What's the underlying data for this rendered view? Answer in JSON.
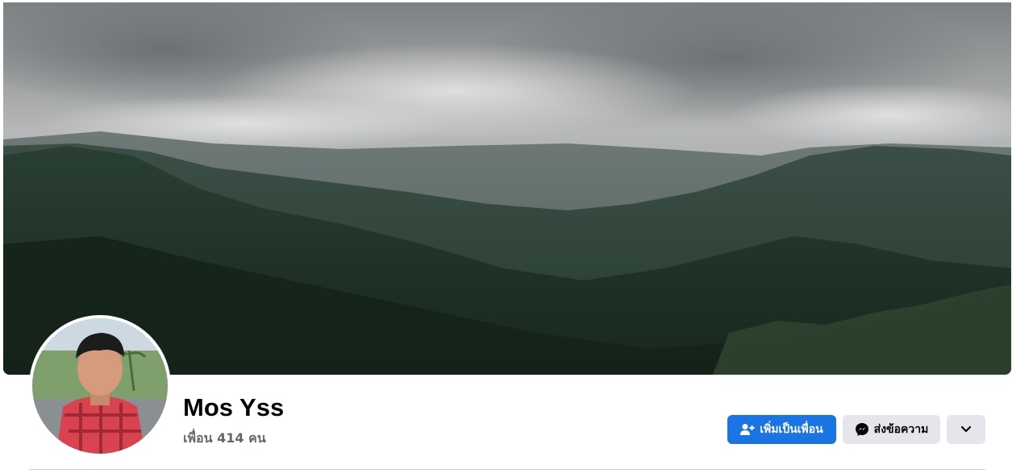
{
  "profile": {
    "name": "Mos Yss",
    "friends_text": "เพื่อน 414 คน"
  },
  "cover": {
    "description_icon": "mountain-landscape-cover-photo"
  },
  "actions": {
    "add_friend_label": "เพิ่มเป็นเพื่อน",
    "add_friend_icon": "person-add-icon",
    "message_label": "ส่งข้อความ",
    "message_icon": "messenger-icon",
    "more_icon": "chevron-down-icon"
  },
  "colors": {
    "primary_button": "#1b74e4",
    "secondary_button": "#e4e6eb",
    "name_text": "#050505",
    "muted_text": "#65676b",
    "divider": "#ced0d4"
  }
}
